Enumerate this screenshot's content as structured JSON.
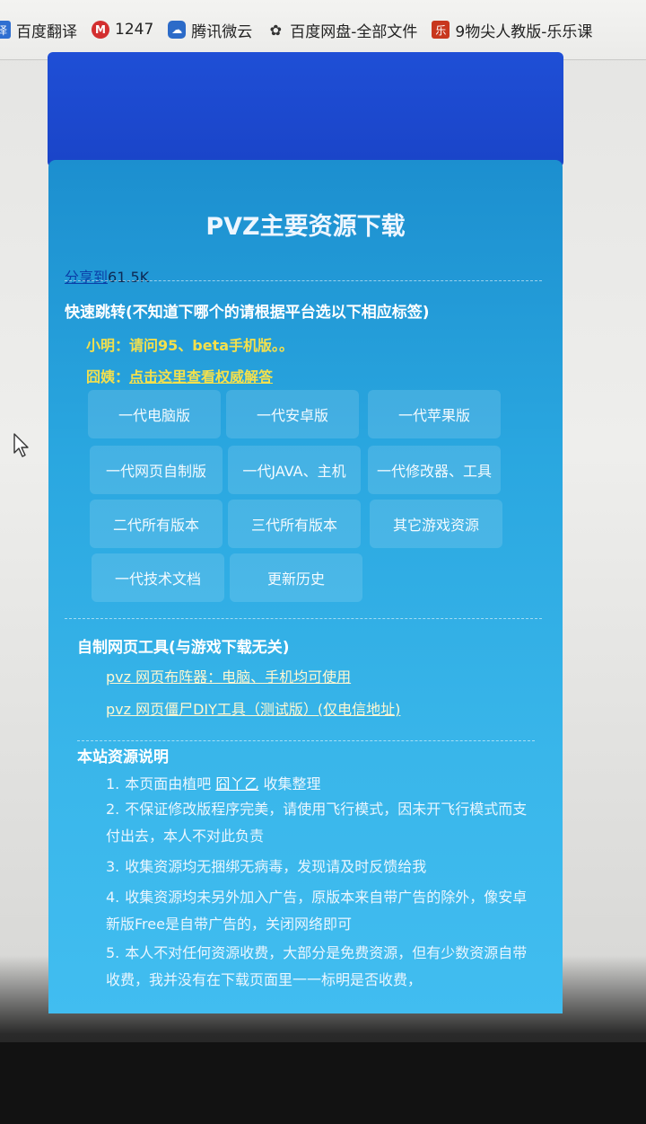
{
  "bookmarks": [
    {
      "icon": "translate-icon",
      "icon_glyph": "译",
      "label": "百度翻译"
    },
    {
      "icon": "m-logo-icon",
      "icon_glyph": "M",
      "label": "1247"
    },
    {
      "icon": "tencent-weiyun-icon",
      "icon_glyph": "☁",
      "label": "腾讯微云"
    },
    {
      "icon": "baidu-pan-icon",
      "icon_glyph": "✿",
      "label": "百度网盘-全部文件"
    },
    {
      "icon": "lele-icon",
      "icon_glyph": "乐",
      "label": "9物尖人教版-乐乐课"
    }
  ],
  "page": {
    "title": "PVZ主要资源下载",
    "share_label": "分享到",
    "share_count": "61.5K",
    "quick_jump_title": "快速跳转(不知道下哪个的请根据平台选以下相应标签)",
    "qa_question": "小明：请问95、beta手机版。。",
    "qa_answer_prefix": "囧姨：",
    "qa_answer_link": "点击这里查看权威解答",
    "tabs": [
      {
        "label": "一代电脑版"
      },
      {
        "label": "一代安卓版"
      },
      {
        "label": "一代苹果版"
      },
      {
        "label": "一代网页自制版"
      },
      {
        "label": "一代JAVA、主机"
      },
      {
        "label": "一代修改器、工具"
      },
      {
        "label": "二代所有版本"
      },
      {
        "label": "三代所有版本"
      },
      {
        "label": "其它游戏资源"
      },
      {
        "label": "一代技术文档"
      },
      {
        "label": "更新历史"
      }
    ],
    "tools_title": "自制网页工具(与游戏下载无关)",
    "tools": [
      {
        "label": "pvz 网页布阵器：电脑、手机均可使用"
      },
      {
        "label": "pvz 网页僵尸DIY工具（测试版）(仅电信地址)"
      }
    ],
    "notes_title": "本站资源说明",
    "notes": {
      "n1_num": "1.",
      "n1_text": "本页面由植吧",
      "n1_link": "囧丫乙",
      "n1_tail": "收集整理",
      "n2_num": "2.",
      "n2_text": "不保证修改版程序完美，请使用飞行模式，因未开飞行模式而支付出去，本人不对此负责",
      "n3_num": "3.",
      "n3_text": "收集资源均无捆绑无病毒，发现请及时反馈给我",
      "n4_num": "4.",
      "n4_text": "收集资源均未另外加入广告，原版本来自带广告的除外，像安卓新版Free是自带广告的，关闭网络即可",
      "n5_num": "5.",
      "n5_text": "本人不对任何资源收费，大部分是免费资源，但有少数资源自带收费，我并没有在下载页面里一一标明是否收费，"
    }
  }
}
